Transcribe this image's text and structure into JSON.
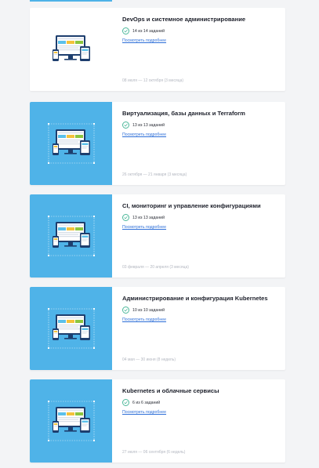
{
  "course_list": {
    "details_label": "Посмотреть подробнее",
    "modules": [
      {
        "title": "DevOps и системное администрирование",
        "progress": "14 из 14 заданий",
        "dates": "08 июля — 12 октября (3 месяца)",
        "thumb_style": "white"
      },
      {
        "title": "Виртуализация, базы данных и Terraform",
        "progress": "13 из 13 заданий",
        "dates": "26 октября — 21 января (3 месяца)",
        "thumb_style": "blue"
      },
      {
        "title": "CI, мониторинг и управление конфигурациями",
        "progress": "13 из 13 заданий",
        "dates": "03 февраля — 20 апреля (3 месяца)",
        "thumb_style": "blue"
      },
      {
        "title": "Администрирование и конфигурация Kubernetes",
        "progress": "10 из 10 заданий",
        "dates": "04 мая — 30 июня (8 недель)",
        "thumb_style": "blue"
      },
      {
        "title": "Kubernetes и облачные сервисы",
        "progress": "6 из 6 заданий",
        "dates": "27 июля — 06 сентября (6 недель)",
        "thumb_style": "blue"
      }
    ]
  },
  "colors": {
    "accent_blue": "#4fb3e8",
    "link": "#2e6fd8",
    "check_green": "#4cb89a"
  },
  "icons": {
    "progress": "check-circle-icon",
    "thumbnail": "responsive-devices-illustration"
  }
}
